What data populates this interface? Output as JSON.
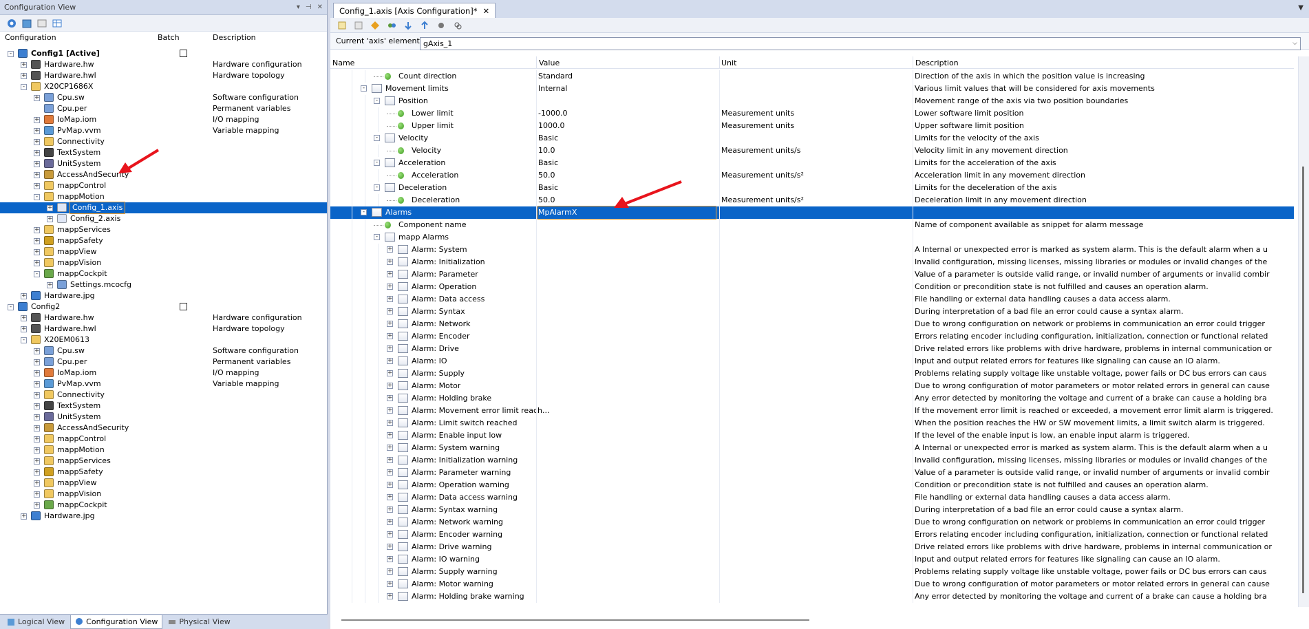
{
  "left_panel": {
    "title": "Configuration View",
    "columns": {
      "configuration": "Configuration",
      "batch": "Batch",
      "description": "Description"
    },
    "rows": [
      {
        "label": "Config1 [Active]",
        "desc": "",
        "level": 0,
        "pm": "-",
        "bold": true,
        "check": true,
        "icon": "config-icon"
      },
      {
        "label": "Hardware.hw",
        "desc": "Hardware configuration",
        "level": 1,
        "pm": "+",
        "icon": "hardware-icon"
      },
      {
        "label": "Hardware.hwl",
        "desc": "Hardware topology",
        "level": 1,
        "pm": "+",
        "icon": "hardware-icon"
      },
      {
        "label": "X20CP1686X",
        "desc": "",
        "level": 1,
        "pm": "-",
        "icon": "folder-icon"
      },
      {
        "label": "Cpu.sw",
        "desc": "Software configuration",
        "level": 2,
        "pm": "+",
        "icon": "file-icon"
      },
      {
        "label": "Cpu.per",
        "desc": "Permanent variables",
        "level": 2,
        "pm": "",
        "icon": "file-icon"
      },
      {
        "label": "IoMap.iom",
        "desc": "I/O mapping",
        "level": 2,
        "pm": "+",
        "icon": "iomap-icon"
      },
      {
        "label": "PvMap.vvm",
        "desc": "Variable mapping",
        "level": 2,
        "pm": "+",
        "icon": "pvmap-icon"
      },
      {
        "label": "Connectivity",
        "desc": "",
        "level": 2,
        "pm": "+",
        "icon": "folder-icon"
      },
      {
        "label": "TextSystem",
        "desc": "",
        "level": 2,
        "pm": "+",
        "icon": "text-icon"
      },
      {
        "label": "UnitSystem",
        "desc": "",
        "level": 2,
        "pm": "+",
        "icon": "unit-icon"
      },
      {
        "label": "AccessAndSecurity",
        "desc": "",
        "level": 2,
        "pm": "+",
        "icon": "security-icon"
      },
      {
        "label": "mappControl",
        "desc": "",
        "level": 2,
        "pm": "+",
        "icon": "folder-icon"
      },
      {
        "label": "mappMotion",
        "desc": "",
        "level": 2,
        "pm": "-",
        "icon": "folder-icon"
      },
      {
        "label": "Config_1.axis",
        "desc": "",
        "level": 3,
        "pm": "+",
        "icon": "axis-icon",
        "selected": true
      },
      {
        "label": "Config_2.axis",
        "desc": "",
        "level": 3,
        "pm": "+",
        "icon": "axis-icon"
      },
      {
        "label": "mappServices",
        "desc": "",
        "level": 2,
        "pm": "+",
        "icon": "folder-icon"
      },
      {
        "label": "mappSafety",
        "desc": "",
        "level": 2,
        "pm": "+",
        "icon": "safety-icon"
      },
      {
        "label": "mappView",
        "desc": "",
        "level": 2,
        "pm": "+",
        "icon": "folder-icon"
      },
      {
        "label": "mappVision",
        "desc": "",
        "level": 2,
        "pm": "+",
        "icon": "folder-icon"
      },
      {
        "label": "mappCockpit",
        "desc": "",
        "level": 2,
        "pm": "-",
        "icon": "cockpit-icon"
      },
      {
        "label": "Settings.mcocfg",
        "desc": "",
        "level": 3,
        "pm": "+",
        "icon": "file-icon"
      },
      {
        "label": "Hardware.jpg",
        "desc": "",
        "level": 1,
        "pm": "+",
        "icon": "image-icon"
      },
      {
        "label": "Config2",
        "desc": "",
        "level": 0,
        "pm": "-",
        "check": true,
        "icon": "config-icon"
      },
      {
        "label": "Hardware.hw",
        "desc": "Hardware configuration",
        "level": 1,
        "pm": "+",
        "icon": "hardware-icon"
      },
      {
        "label": "Hardware.hwl",
        "desc": "Hardware topology",
        "level": 1,
        "pm": "+",
        "icon": "hardware-icon"
      },
      {
        "label": "X20EM0613",
        "desc": "",
        "level": 1,
        "pm": "-",
        "icon": "folder-icon"
      },
      {
        "label": "Cpu.sw",
        "desc": "Software configuration",
        "level": 2,
        "pm": "+",
        "icon": "file-icon"
      },
      {
        "label": "Cpu.per",
        "desc": "Permanent variables",
        "level": 2,
        "pm": "+",
        "icon": "file-icon"
      },
      {
        "label": "IoMap.iom",
        "desc": "I/O mapping",
        "level": 2,
        "pm": "+",
        "icon": "iomap-icon"
      },
      {
        "label": "PvMap.vvm",
        "desc": "Variable mapping",
        "level": 2,
        "pm": "+",
        "icon": "pvmap-icon"
      },
      {
        "label": "Connectivity",
        "desc": "",
        "level": 2,
        "pm": "+",
        "icon": "folder-icon"
      },
      {
        "label": "TextSystem",
        "desc": "",
        "level": 2,
        "pm": "+",
        "icon": "text-icon"
      },
      {
        "label": "UnitSystem",
        "desc": "",
        "level": 2,
        "pm": "+",
        "icon": "unit-icon"
      },
      {
        "label": "AccessAndSecurity",
        "desc": "",
        "level": 2,
        "pm": "+",
        "icon": "security-icon"
      },
      {
        "label": "mappControl",
        "desc": "",
        "level": 2,
        "pm": "+",
        "icon": "folder-icon"
      },
      {
        "label": "mappMotion",
        "desc": "",
        "level": 2,
        "pm": "+",
        "icon": "folder-icon"
      },
      {
        "label": "mappServices",
        "desc": "",
        "level": 2,
        "pm": "+",
        "icon": "folder-icon"
      },
      {
        "label": "mappSafety",
        "desc": "",
        "level": 2,
        "pm": "+",
        "icon": "safety-icon"
      },
      {
        "label": "mappView",
        "desc": "",
        "level": 2,
        "pm": "+",
        "icon": "folder-icon"
      },
      {
        "label": "mappVision",
        "desc": "",
        "level": 2,
        "pm": "+",
        "icon": "folder-icon"
      },
      {
        "label": "mappCockpit",
        "desc": "",
        "level": 2,
        "pm": "+",
        "icon": "cockpit-icon"
      },
      {
        "label": "Hardware.jpg",
        "desc": "",
        "level": 1,
        "pm": "+",
        "icon": "image-icon"
      }
    ],
    "bottom_tabs": [
      "Logical View",
      "Configuration View",
      "Physical View"
    ]
  },
  "editor": {
    "tab_label": "Config_1.axis [Axis Configuration]*",
    "element_label": "Current 'axis' element:",
    "element_value": "gAxis_1",
    "columns": {
      "name": "Name",
      "value": "Value",
      "unit": "Unit",
      "description": "Description"
    },
    "rows": [
      {
        "name": "Count direction",
        "value": "Standard",
        "unit": "",
        "desc": "Direction of the axis in which the position value is increasing",
        "level": 3,
        "kind": "leaf"
      },
      {
        "name": "Movement limits",
        "value": "Internal",
        "unit": "",
        "desc": "Various limit values that will be considered for axis movements",
        "level": 2,
        "kind": "folder",
        "pm": "-"
      },
      {
        "name": "Position",
        "value": "",
        "unit": "",
        "desc": "Movement range of the axis via two position boundaries",
        "level": 3,
        "kind": "folder",
        "pm": "-"
      },
      {
        "name": "Lower limit",
        "value": "-1000.0",
        "unit": "Measurement units",
        "desc": "Lower software limit position",
        "level": 4,
        "kind": "leaf"
      },
      {
        "name": "Upper limit",
        "value": "1000.0",
        "unit": "Measurement units",
        "desc": "Upper software limit position",
        "level": 4,
        "kind": "leaf"
      },
      {
        "name": "Velocity",
        "value": "Basic",
        "unit": "",
        "desc": "Limits for the velocity of the axis",
        "level": 3,
        "kind": "folder",
        "pm": "-"
      },
      {
        "name": "Velocity",
        "value": "10.0",
        "unit": "Measurement units/s",
        "desc": "Velocity limit in any movement direction",
        "level": 4,
        "kind": "leaf"
      },
      {
        "name": "Acceleration",
        "value": "Basic",
        "unit": "",
        "desc": "Limits for the acceleration of the axis",
        "level": 3,
        "kind": "folder",
        "pm": "-"
      },
      {
        "name": "Acceleration",
        "value": "50.0",
        "unit": "Measurement units/s²",
        "desc": "Acceleration limit in any movement direction",
        "level": 4,
        "kind": "leaf"
      },
      {
        "name": "Deceleration",
        "value": "Basic",
        "unit": "",
        "desc": "Limits for the deceleration of the axis",
        "level": 3,
        "kind": "folder",
        "pm": "-"
      },
      {
        "name": "Deceleration",
        "value": "50.0",
        "unit": "Measurement units/s²",
        "desc": "Deceleration limit in any movement direction",
        "level": 4,
        "kind": "leaf"
      },
      {
        "name": "Alarms",
        "value": "MpAlarmX",
        "unit": "",
        "desc": "",
        "level": 2,
        "kind": "folder",
        "pm": "-",
        "selected": true
      },
      {
        "name": "Component name",
        "value": "",
        "unit": "",
        "desc": "Name of component available as snippet for alarm message",
        "level": 3,
        "kind": "leaf"
      },
      {
        "name": "mapp Alarms",
        "value": "",
        "unit": "",
        "desc": "",
        "level": 3,
        "kind": "folder",
        "pm": "-"
      },
      {
        "name": "Alarm: System",
        "value": "",
        "unit": "",
        "desc": "A Internal or unexpected error is marked as system alarm. This is the default alarm when a u",
        "level": 4,
        "kind": "folder",
        "pm": "+"
      },
      {
        "name": "Alarm: Initialization",
        "value": "",
        "unit": "",
        "desc": "Invalid configuration, missing licenses, missing libraries or modules or invalid changes of the",
        "level": 4,
        "kind": "folder",
        "pm": "+"
      },
      {
        "name": "Alarm: Parameter",
        "value": "",
        "unit": "",
        "desc": "Value of a parameter is outside valid range, or invalid number of arguments or invalid combir",
        "level": 4,
        "kind": "folder",
        "pm": "+"
      },
      {
        "name": "Alarm: Operation",
        "value": "",
        "unit": "",
        "desc": "Condition or precondition state is not fulfilled and causes an operation alarm.",
        "level": 4,
        "kind": "folder",
        "pm": "+"
      },
      {
        "name": "Alarm: Data access",
        "value": "",
        "unit": "",
        "desc": "File handling or external data handling causes a data access alarm.",
        "level": 4,
        "kind": "folder",
        "pm": "+"
      },
      {
        "name": "Alarm: Syntax",
        "value": "",
        "unit": "",
        "desc": "During interpretation of a bad file an error could cause a syntax alarm.",
        "level": 4,
        "kind": "folder",
        "pm": "+"
      },
      {
        "name": "Alarm: Network",
        "value": "",
        "unit": "",
        "desc": "Due to wrong configuration on network or problems in communication an error could trigger",
        "level": 4,
        "kind": "folder",
        "pm": "+"
      },
      {
        "name": "Alarm: Encoder",
        "value": "",
        "unit": "",
        "desc": "Errors relating encoder including configuration, initialization, connection or functional related",
        "level": 4,
        "kind": "folder",
        "pm": "+"
      },
      {
        "name": "Alarm: Drive",
        "value": "",
        "unit": "",
        "desc": "Drive related errors like problems with drive hardware, problems in internal communication or",
        "level": 4,
        "kind": "folder",
        "pm": "+"
      },
      {
        "name": "Alarm: IO",
        "value": "",
        "unit": "",
        "desc": "Input and output related errors for features like signaling can cause an IO alarm.",
        "level": 4,
        "kind": "folder",
        "pm": "+"
      },
      {
        "name": "Alarm: Supply",
        "value": "",
        "unit": "",
        "desc": "Problems relating supply voltage like unstable voltage, power fails or DC bus errors can caus",
        "level": 4,
        "kind": "folder",
        "pm": "+"
      },
      {
        "name": "Alarm: Motor",
        "value": "",
        "unit": "",
        "desc": "Due to wrong configuration of motor parameters or motor related errors in general can cause",
        "level": 4,
        "kind": "folder",
        "pm": "+"
      },
      {
        "name": "Alarm: Holding brake",
        "value": "",
        "unit": "",
        "desc": "Any error detected by monitoring the voltage and current of a brake can cause a holding bra",
        "level": 4,
        "kind": "folder",
        "pm": "+"
      },
      {
        "name": "Alarm: Movement error limit reach...",
        "value": "",
        "unit": "",
        "desc": "If the movement error limit is reached or exceeded, a movement error limit alarm is triggered.",
        "level": 4,
        "kind": "folder",
        "pm": "+"
      },
      {
        "name": "Alarm: Limit switch reached",
        "value": "",
        "unit": "",
        "desc": "When the position reaches the HW or SW movement limits, a limit switch alarm is triggered.",
        "level": 4,
        "kind": "folder",
        "pm": "+"
      },
      {
        "name": "Alarm: Enable input low",
        "value": "",
        "unit": "",
        "desc": "If the level of the enable input is low, an enable input alarm is triggered.",
        "level": 4,
        "kind": "folder",
        "pm": "+"
      },
      {
        "name": "Alarm: System warning",
        "value": "",
        "unit": "",
        "desc": "A Internal or unexpected error is marked as system alarm. This is the default alarm when a u",
        "level": 4,
        "kind": "folder",
        "pm": "+"
      },
      {
        "name": "Alarm: Initialization warning",
        "value": "",
        "unit": "",
        "desc": "Invalid configuration, missing licenses, missing libraries or modules or invalid changes of the",
        "level": 4,
        "kind": "folder",
        "pm": "+"
      },
      {
        "name": "Alarm: Parameter warning",
        "value": "",
        "unit": "",
        "desc": "Value of a parameter is outside valid range, or invalid number of arguments or invalid combir",
        "level": 4,
        "kind": "folder",
        "pm": "+"
      },
      {
        "name": "Alarm: Operation warning",
        "value": "",
        "unit": "",
        "desc": "Condition or precondition state is not fulfilled and causes an operation alarm.",
        "level": 4,
        "kind": "folder",
        "pm": "+"
      },
      {
        "name": "Alarm: Data access warning",
        "value": "",
        "unit": "",
        "desc": "File handling or external data handling causes a data access alarm.",
        "level": 4,
        "kind": "folder",
        "pm": "+"
      },
      {
        "name": "Alarm: Syntax warning",
        "value": "",
        "unit": "",
        "desc": "During interpretation of a bad file an error could cause a syntax alarm.",
        "level": 4,
        "kind": "folder",
        "pm": "+"
      },
      {
        "name": "Alarm: Network warning",
        "value": "",
        "unit": "",
        "desc": "Due to wrong configuration on network or problems in communication an error could trigger",
        "level": 4,
        "kind": "folder",
        "pm": "+"
      },
      {
        "name": "Alarm: Encoder warning",
        "value": "",
        "unit": "",
        "desc": "Errors relating encoder including configuration, initialization, connection or functional related",
        "level": 4,
        "kind": "folder",
        "pm": "+"
      },
      {
        "name": "Alarm: Drive warning",
        "value": "",
        "unit": "",
        "desc": "Drive related errors like problems with drive hardware, problems in internal communication or",
        "level": 4,
        "kind": "folder",
        "pm": "+"
      },
      {
        "name": "Alarm: IO warning",
        "value": "",
        "unit": "",
        "desc": "Input and output related errors for features like signaling can cause an IO alarm.",
        "level": 4,
        "kind": "folder",
        "pm": "+"
      },
      {
        "name": "Alarm: Supply warning",
        "value": "",
        "unit": "",
        "desc": "Problems relating supply voltage like unstable voltage, power fails or DC bus errors can caus",
        "level": 4,
        "kind": "folder",
        "pm": "+"
      },
      {
        "name": "Alarm: Motor warning",
        "value": "",
        "unit": "",
        "desc": "Due to wrong configuration of motor parameters or motor related errors in general can cause",
        "level": 4,
        "kind": "folder",
        "pm": "+"
      },
      {
        "name": "Alarm: Holding brake warning",
        "value": "",
        "unit": "",
        "desc": "Any error detected by monitoring the voltage and current of a brake can cause a holding bra",
        "level": 4,
        "kind": "folder",
        "pm": "+"
      }
    ]
  },
  "colors": {
    "selection": "#0a64c8",
    "annotation_arrow": "#e8141c",
    "focus_outline": "#f0a030"
  }
}
